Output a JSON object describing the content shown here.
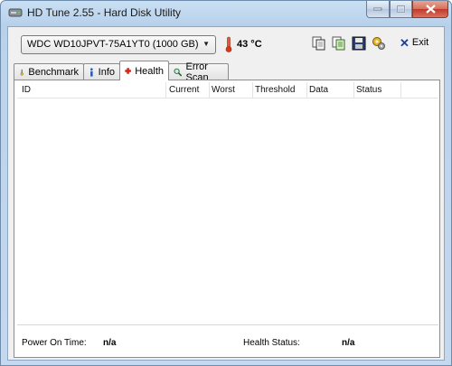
{
  "window": {
    "title": "HD Tune 2.55 - Hard Disk Utility"
  },
  "icons": {
    "app": "hard-disk-icon",
    "temperature": "thermometer-icon",
    "copy_info": "copy-info-icon",
    "copy_screen": "copy-screenshot-icon",
    "save": "save-icon",
    "options": "options-icon",
    "exit": "close-icon"
  },
  "toolbar": {
    "drive_selected": "WDC WD10JPVT-75A1YT0 (1000 GB)",
    "temperature": "43 °C",
    "exit_label": "Exit"
  },
  "tabs": [
    {
      "label": "Benchmark",
      "icon": "gauge-icon"
    },
    {
      "label": "Info",
      "icon": "info-icon"
    },
    {
      "label": "Health",
      "icon": "health-cross-icon",
      "active": true
    },
    {
      "label": "Error Scan",
      "icon": "magnifier-icon"
    }
  ],
  "health": {
    "columns": [
      "ID",
      "Current",
      "Worst",
      "Threshold",
      "Data",
      "Status"
    ],
    "rows": [],
    "power_on_time_label": "Power On Time:",
    "power_on_time_value": "n/a",
    "health_status_label": "Health Status:",
    "health_status_value": "n/a"
  }
}
